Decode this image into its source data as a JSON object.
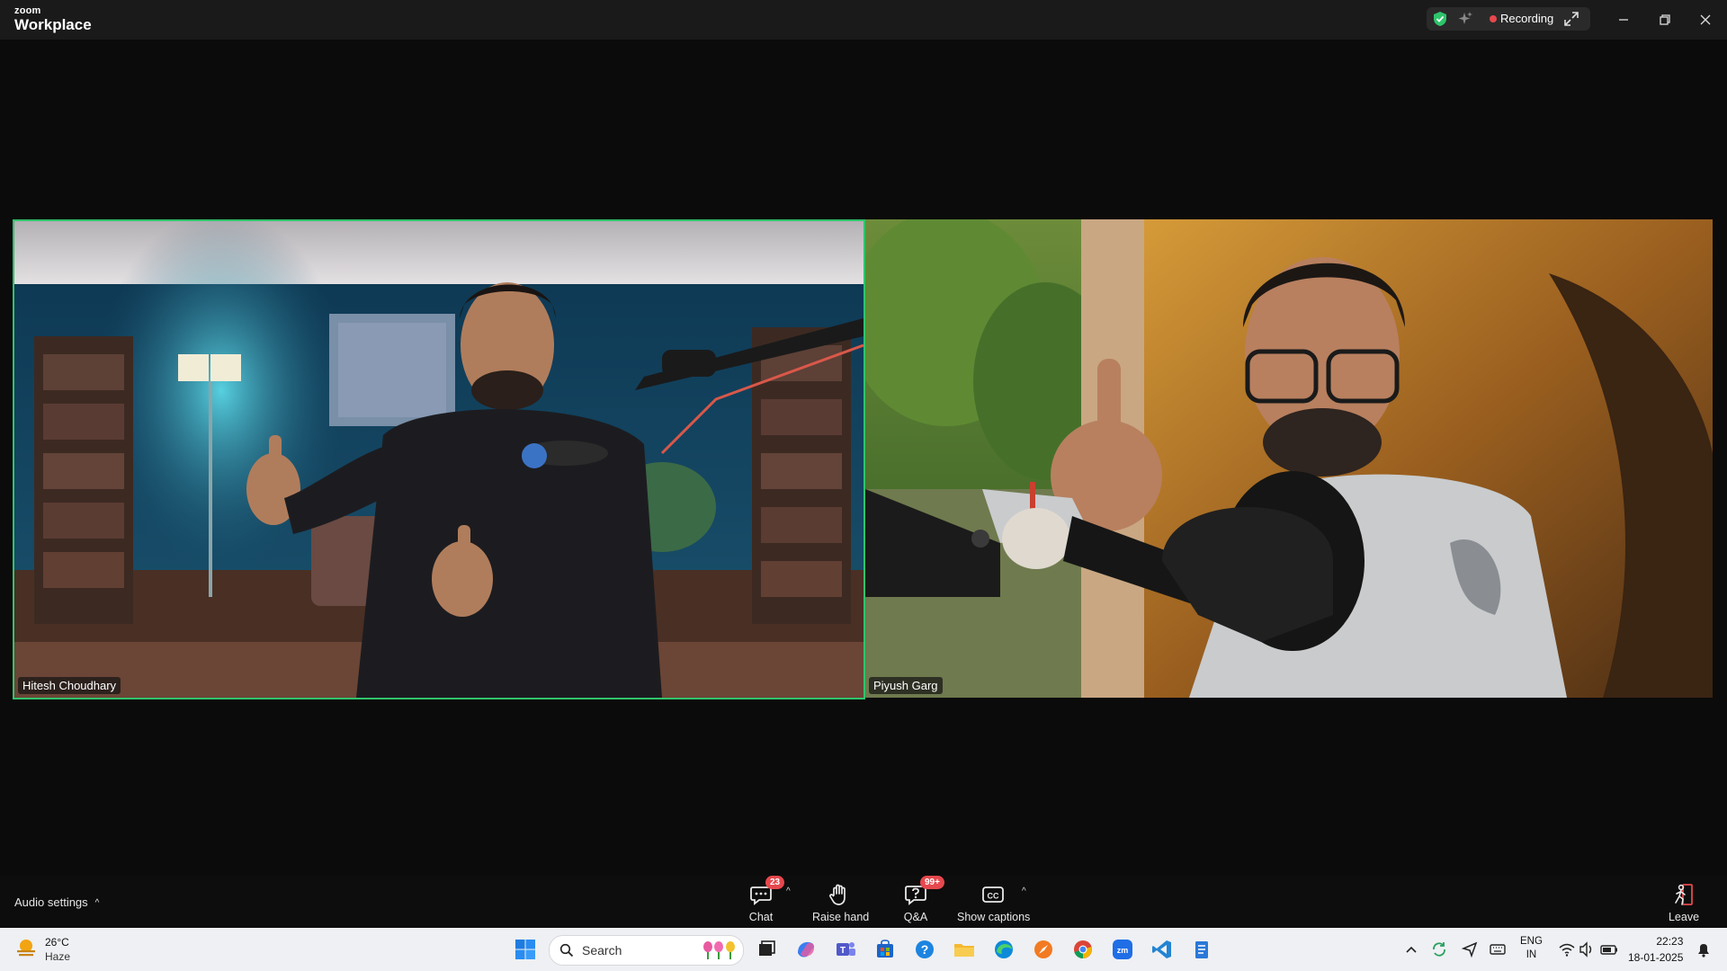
{
  "app": {
    "logo_top": "zoom",
    "logo_bottom": "Workplace",
    "recording_label": "Recording",
    "icons": [
      "security-shield-icon",
      "ai-companion-icon",
      "expand-icon",
      "minimize-icon",
      "restore-icon",
      "close-icon"
    ]
  },
  "participants": [
    {
      "name": "Hitesh Choudhary",
      "speaking": true
    },
    {
      "name": "Piyush Garg",
      "speaking": false
    }
  ],
  "toolbar": {
    "audio_settings": "Audio settings",
    "chat_label": "Chat",
    "chat_badge": "23",
    "raise_hand_label": "Raise hand",
    "qa_label": "Q&A",
    "qa_badge": "99+",
    "captions_label": "Show captions",
    "leave_label": "Leave",
    "active_speaker_color": "#2fc46b",
    "badge_color": "#e5484d"
  },
  "taskbar": {
    "weather_temp": "26°C",
    "weather_cond": "Haze",
    "search_placeholder": "Search",
    "pinned": [
      "windows-start-icon",
      "task-view-icon",
      "copilot-icon",
      "teams-icon",
      "store-icon",
      "help-icon",
      "file-explorer-icon",
      "edge-icon",
      "compass-icon",
      "chrome-icon",
      "zoom-icon",
      "vscode-icon",
      "notepad-icon"
    ],
    "lang_top": "ENG",
    "lang_bottom": "IN",
    "time": "22:23",
    "date": "18-01-2025"
  }
}
